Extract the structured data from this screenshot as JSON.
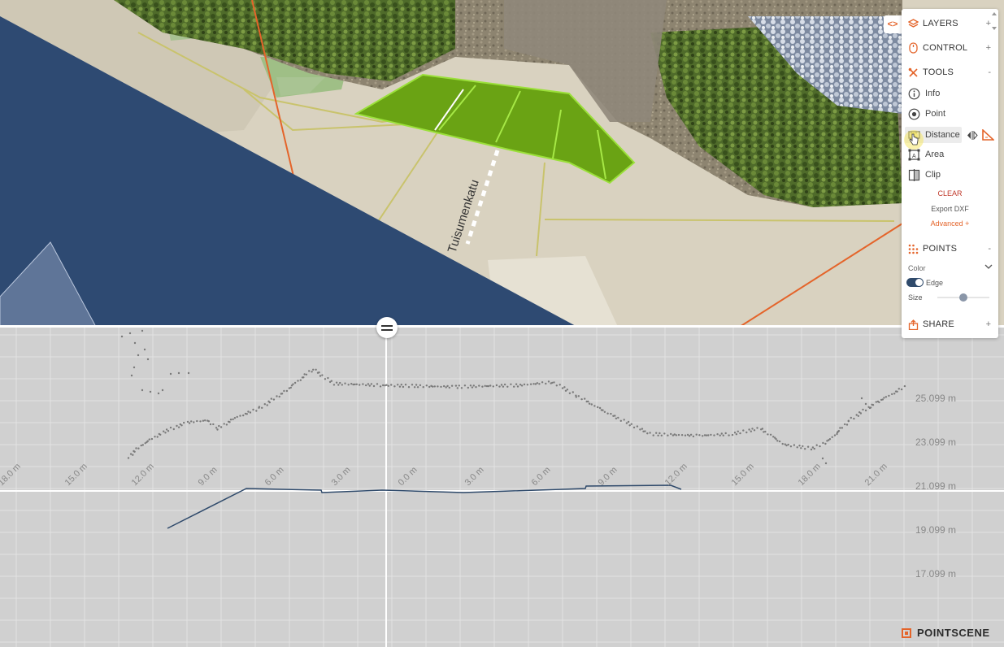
{
  "map": {
    "street_label": "Tuisumenkatu"
  },
  "panel": {
    "collapse_symbol": "<>",
    "sections": {
      "layers": {
        "label": "LAYERS",
        "toggle": "+"
      },
      "control": {
        "label": "CONTROL",
        "toggle": "+"
      },
      "tools": {
        "label": "TOOLS",
        "toggle": "-"
      },
      "points": {
        "label": "POINTS",
        "toggle": "-"
      },
      "share": {
        "label": "SHARE",
        "toggle": "+"
      }
    },
    "tools": {
      "info": "Info",
      "point": "Point",
      "distance": "Distance",
      "area": "Area",
      "clip": "Clip",
      "clear": "CLEAR",
      "export_dxf": "Export DXF",
      "advanced": "Advanced +"
    },
    "points": {
      "color_label": "Color",
      "edge_label": "Edge",
      "edge_enabled": true,
      "size_label": "Size",
      "size_value": 0.5
    }
  },
  "profile": {
    "x_ticks": [
      "18.0 m",
      "15.0 m",
      "12.0 m",
      "9.0 m",
      "6.0 m",
      "3.0 m",
      "0.0 m",
      "3.0 m",
      "6.0 m",
      "9.0 m",
      "12.0 m",
      "15.0 m",
      "18.0 m",
      "21.0 m"
    ],
    "y_ticks": [
      "25.099 m",
      "23.099 m",
      "21.099 m",
      "19.099 m",
      "17.099 m"
    ]
  },
  "brand": {
    "name": "POINTSCENE"
  },
  "colors": {
    "accent": "#e4642a",
    "clear": "#c0392b",
    "profile_line": "#2f4a6b",
    "measure_fill": "#7fbf1a"
  }
}
